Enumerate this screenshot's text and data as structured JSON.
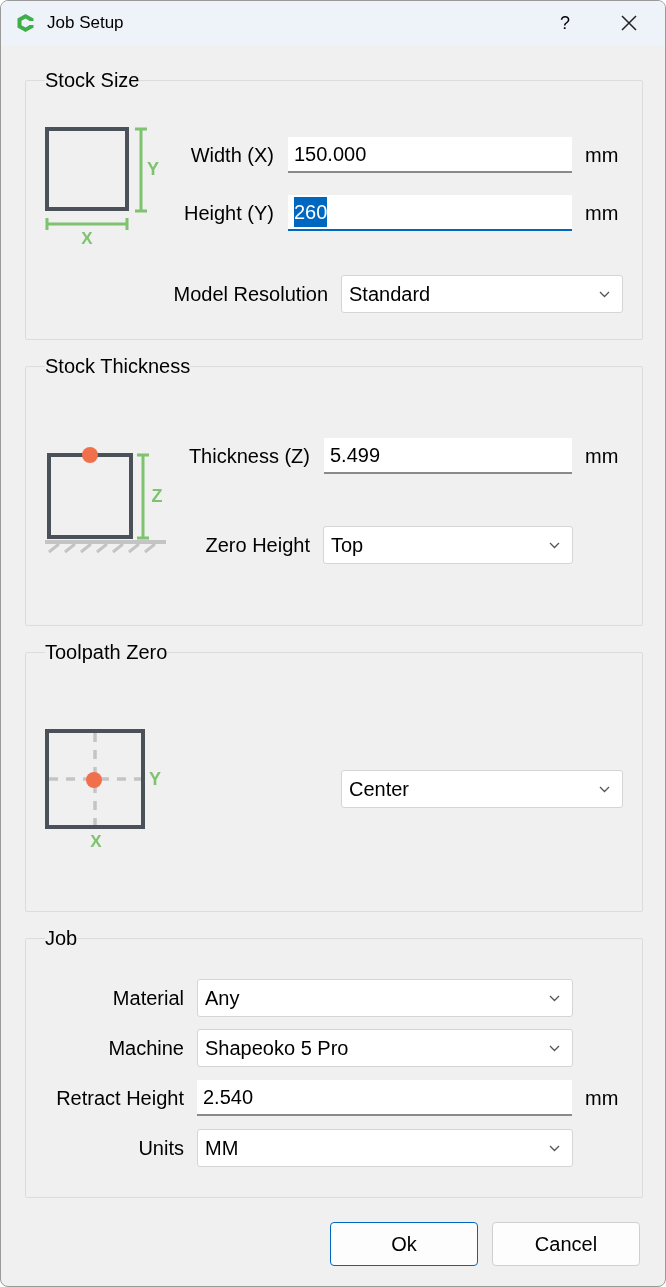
{
  "window": {
    "title": "Job Setup",
    "help": "?"
  },
  "stock_size": {
    "title": "Stock Size",
    "diagram": {
      "x_label": "X",
      "y_label": "Y"
    },
    "fields": [
      {
        "label": "Width (X)",
        "value": "150.000",
        "unit": "mm",
        "focused": false
      },
      {
        "label": "Height (Y)",
        "value": "260",
        "unit": "mm",
        "focused": true
      }
    ],
    "resolution": {
      "label": "Model Resolution",
      "value": "Standard"
    }
  },
  "stock_thickness": {
    "title": "Stock Thickness",
    "diagram": {
      "z_label": "Z"
    },
    "thickness": {
      "label": "Thickness (Z)",
      "value": "5.499",
      "unit": "mm"
    },
    "zero_height": {
      "label": "Zero Height",
      "value": "Top"
    }
  },
  "toolpath_zero": {
    "title": "Toolpath Zero",
    "diagram": {
      "x_label": "X",
      "y_label": "Y"
    },
    "position": {
      "value": "Center"
    }
  },
  "job": {
    "title": "Job",
    "rows": [
      {
        "kind": "select",
        "label": "Material",
        "value": "Any"
      },
      {
        "kind": "select",
        "label": "Machine",
        "value": "Shapeoko 5 Pro"
      },
      {
        "kind": "input",
        "label": "Retract Height",
        "value": "2.540",
        "unit": "mm"
      },
      {
        "kind": "select",
        "label": "Units",
        "value": "MM"
      }
    ]
  },
  "buttons": [
    {
      "label": "Ok",
      "default": true
    },
    {
      "label": "Cancel",
      "default": false
    }
  ]
}
